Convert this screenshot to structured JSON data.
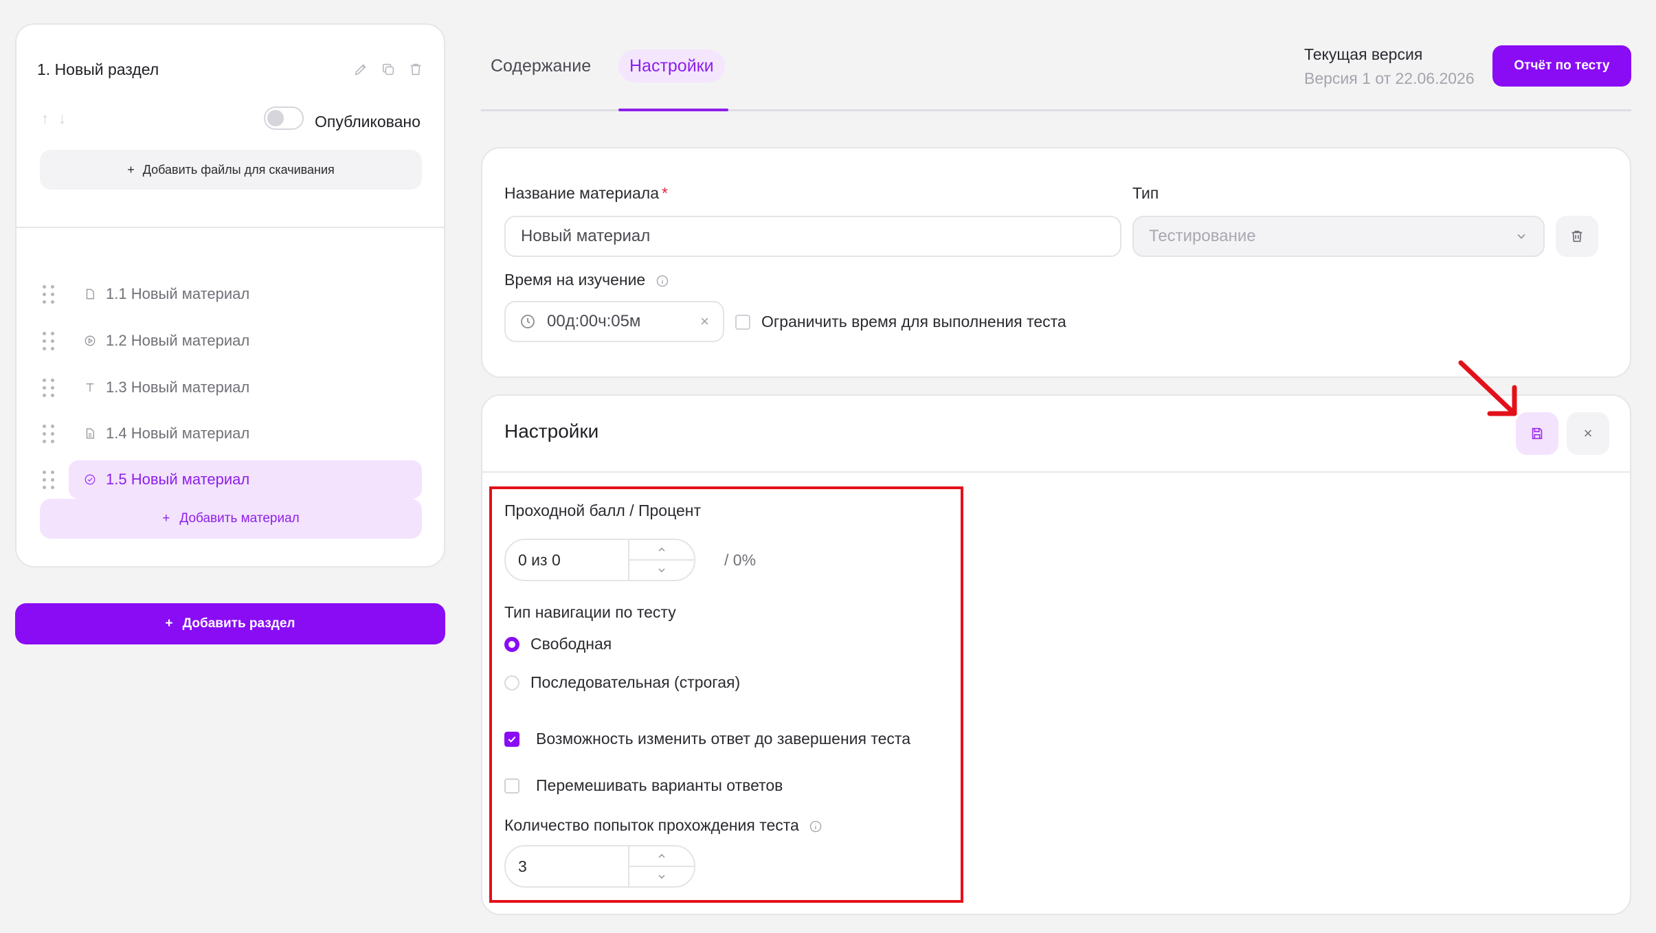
{
  "sidebar": {
    "section_title": "1. Новый раздел",
    "published_label": "Опубликовано",
    "add_files_label": "Добавить файлы для скачивания",
    "materials": [
      {
        "label": "1.1 Новый материал",
        "icon": "document-icon",
        "active": false
      },
      {
        "label": "1.2 Новый материал",
        "icon": "video-icon",
        "active": false
      },
      {
        "label": "1.3 Новый материал",
        "icon": "text-icon",
        "active": false
      },
      {
        "label": "1.4 Новый материал",
        "icon": "file-icon",
        "active": false
      },
      {
        "label": "1.5 Новый материал",
        "icon": "test-icon",
        "active": true
      }
    ],
    "add_material_label": "Добавить материал",
    "add_section_label": "Добавить раздел"
  },
  "tabs": [
    {
      "label": "Содержание",
      "active": false
    },
    {
      "label": "Настройки",
      "active": true
    }
  ],
  "version": {
    "title": "Текущая версия",
    "subtitle": "Версия 1 от 22.06.2026"
  },
  "report_button": "Отчёт по тесту",
  "material": {
    "name_label": "Название материала",
    "name_value": "Новый материал",
    "type_label": "Тип",
    "type_value": "Тестирование",
    "time_label": "Время на изучение",
    "time_value": "00д:00ч:05м",
    "limit_time_label": "Ограничить время для выполнения теста",
    "limit_time_checked": false
  },
  "settings": {
    "title": "Настройки",
    "passing_label": "Проходной балл / Процент",
    "passing_value": "0 из 0",
    "passing_percent": "/ 0%",
    "nav_label": "Тип навигации по тесту",
    "nav_options": [
      {
        "label": "Свободная",
        "selected": true
      },
      {
        "label": "Последовательная (строгая)",
        "selected": false
      }
    ],
    "change_answer_label": "Возможность изменить ответ до завершения теста",
    "change_answer_checked": true,
    "shuffle_label": "Перемешивать варианты ответов",
    "shuffle_checked": false,
    "attempts_label": "Количество попыток прохождения теста",
    "attempts_value": "3"
  },
  "colors": {
    "accent": "#8a0cf5",
    "accent_light": "#f3e3fd",
    "highlight": "#e3101a"
  }
}
